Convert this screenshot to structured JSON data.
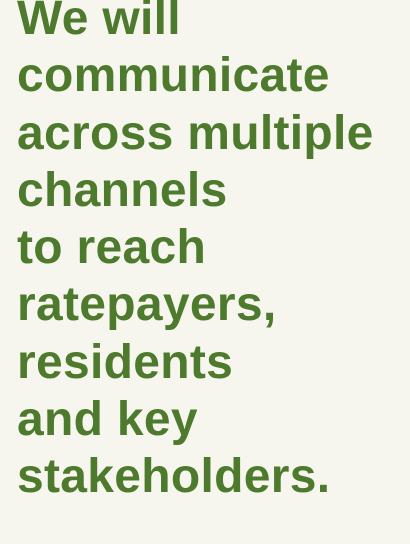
{
  "statement": {
    "lines": [
      "We will",
      "communicate",
      "across multiple",
      "channels",
      "to reach",
      "ratepayers,",
      "residents",
      "and key",
      "stakeholders."
    ]
  },
  "colors": {
    "background": "#f7f6ee",
    "text": "#4d7a2c"
  }
}
